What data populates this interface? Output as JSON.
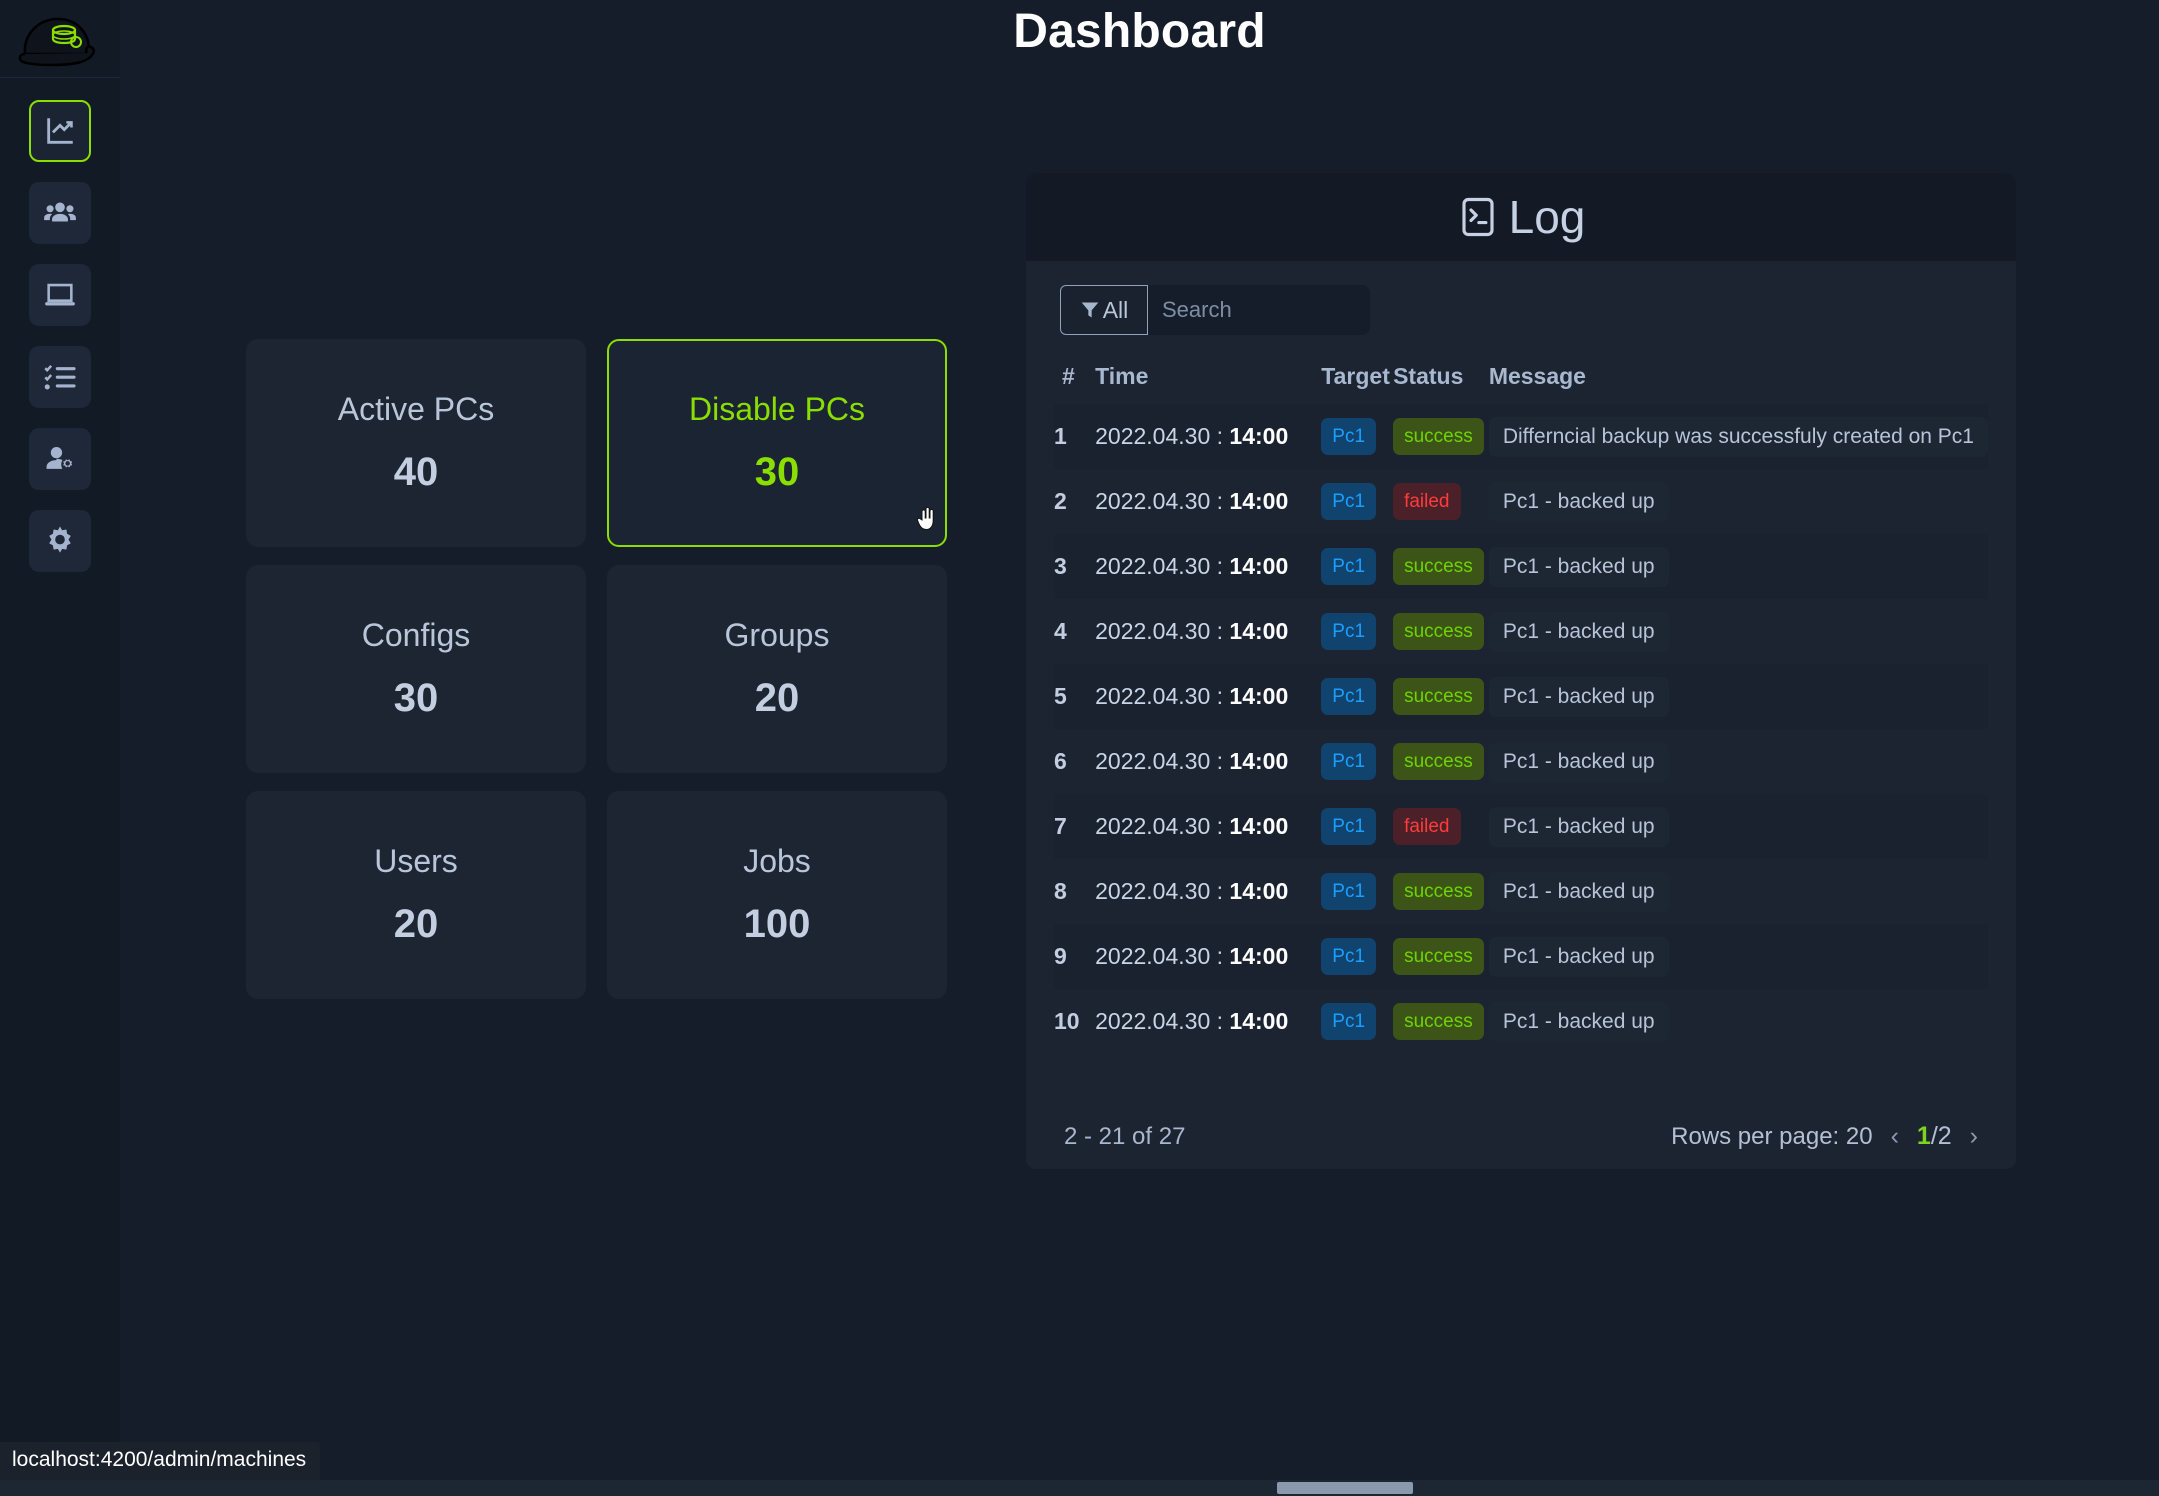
{
  "header": {
    "title": "Dashboard"
  },
  "sidebar": {
    "logo": {
      "icon": "cap-database-logo"
    },
    "items": [
      {
        "icon": "chart-line-icon",
        "name": "dashboard",
        "active": true
      },
      {
        "icon": "users-group-icon",
        "name": "groups",
        "active": false
      },
      {
        "icon": "laptop-icon",
        "name": "machines",
        "active": false
      },
      {
        "icon": "checklist-icon",
        "name": "jobs",
        "active": false
      },
      {
        "icon": "user-settings-icon",
        "name": "users",
        "active": false
      },
      {
        "icon": "gear-icon",
        "name": "settings",
        "active": false
      }
    ],
    "user": {
      "avatar_icon": "user-avatar-icon",
      "caret_icon": "caret-down-icon"
    }
  },
  "stats": [
    {
      "label": "Active PCs",
      "value": "40",
      "hovered": false
    },
    {
      "label": "Disable PCs",
      "value": "30",
      "hovered": true
    },
    {
      "label": "Configs",
      "value": "30",
      "hovered": false
    },
    {
      "label": "Groups",
      "value": "20",
      "hovered": false
    },
    {
      "label": "Users",
      "value": "20",
      "hovered": false
    },
    {
      "label": "Jobs",
      "value": "100",
      "hovered": false
    }
  ],
  "log": {
    "title": "Log",
    "title_icon": "terminal-icon",
    "filter": {
      "label": "All",
      "icon": "filter-funnel-icon"
    },
    "search": {
      "placeholder": "Search",
      "value": ""
    },
    "columns": {
      "idx": "#",
      "time": "Time",
      "target": "Target",
      "status": "Status",
      "message": "Message"
    },
    "rows": [
      {
        "idx": "1",
        "date": "2022.04.30 : ",
        "time": "14:00",
        "target": "Pc1",
        "status": "success",
        "message": "Differncial backup was successfuly created on Pc1"
      },
      {
        "idx": "2",
        "date": "2022.04.30 : ",
        "time": "14:00",
        "target": "Pc1",
        "status": "failed",
        "message": "Pc1 - backed up"
      },
      {
        "idx": "3",
        "date": "2022.04.30 : ",
        "time": "14:00",
        "target": "Pc1",
        "status": "success",
        "message": "Pc1 - backed up"
      },
      {
        "idx": "4",
        "date": "2022.04.30 : ",
        "time": "14:00",
        "target": "Pc1",
        "status": "success",
        "message": "Pc1 - backed up"
      },
      {
        "idx": "5",
        "date": "2022.04.30 : ",
        "time": "14:00",
        "target": "Pc1",
        "status": "success",
        "message": "Pc1 - backed up"
      },
      {
        "idx": "6",
        "date": "2022.04.30 : ",
        "time": "14:00",
        "target": "Pc1",
        "status": "success",
        "message": "Pc1 - backed up"
      },
      {
        "idx": "7",
        "date": "2022.04.30 : ",
        "time": "14:00",
        "target": "Pc1",
        "status": "failed",
        "message": "Pc1 - backed up"
      },
      {
        "idx": "8",
        "date": "2022.04.30 : ",
        "time": "14:00",
        "target": "Pc1",
        "status": "success",
        "message": "Pc1 - backed up"
      },
      {
        "idx": "9",
        "date": "2022.04.30 : ",
        "time": "14:00",
        "target": "Pc1",
        "status": "success",
        "message": "Pc1 - backed up"
      },
      {
        "idx": "10",
        "date": "2022.04.30 : ",
        "time": "14:00",
        "target": "Pc1",
        "status": "success",
        "message": "Pc1 - backed up"
      }
    ],
    "footer": {
      "range": "2 - 21 of 27",
      "rows_per_page": "Rows per page: 20",
      "prev_icon": "chevron-left-icon",
      "next_icon": "chevron-right-icon",
      "page_current": "1",
      "page_total": "/2"
    }
  },
  "status_bar": {
    "url": "localhost:4200/admin/machines"
  },
  "colors": {
    "background": "#151d2b",
    "card": "#1d2533",
    "panel": "#1c2432",
    "panel_header": "#131a26",
    "accent_green": "#8ade00",
    "text_primary": "#c6d2e3",
    "text_muted": "#a8b8cf",
    "badge_target_bg": "#11436f",
    "badge_target_fg": "#1a9fff",
    "badge_success_bg": "#3d5419",
    "badge_success_fg": "#6dd400",
    "badge_failed_bg": "#4b2028",
    "badge_failed_fg": "#ff3b3b"
  }
}
